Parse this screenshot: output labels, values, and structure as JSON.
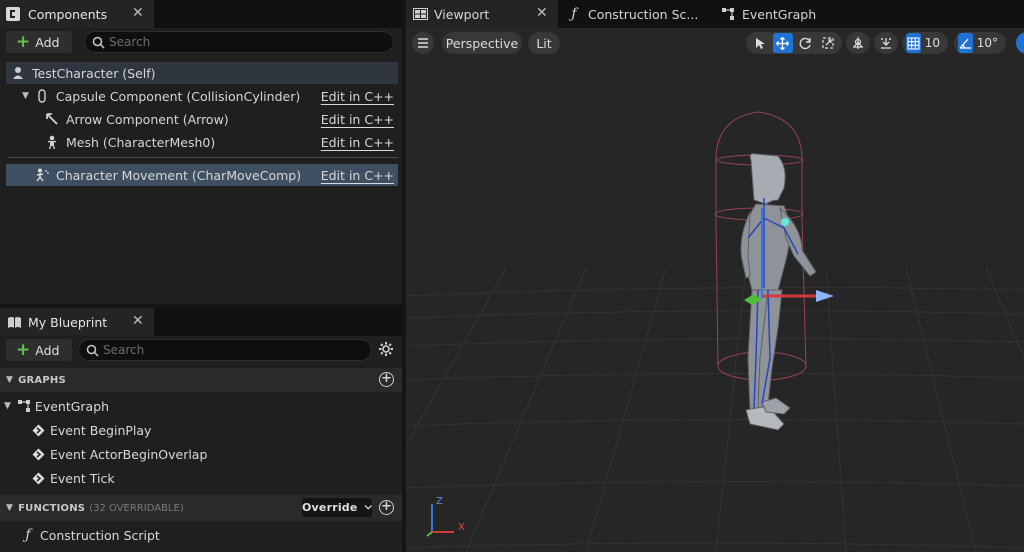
{
  "components_panel": {
    "tab_title": "Components",
    "add_label": "Add",
    "search_placeholder": "Search",
    "root": "TestCharacter (Self)",
    "items": [
      {
        "label": "Capsule Component (CollisionCylinder)",
        "action": "Edit in C++"
      },
      {
        "label": "Arrow Component (Arrow)",
        "action": "Edit in C++"
      },
      {
        "label": "Mesh (CharacterMesh0)",
        "action": "Edit in C++"
      },
      {
        "label": "Character Movement (CharMoveComp)",
        "action": "Edit in C++"
      }
    ]
  },
  "blueprint_panel": {
    "tab_title": "My Blueprint",
    "add_label": "Add",
    "search_placeholder": "Search",
    "graphs_header": "GRAPHS",
    "event_graph": "EventGraph",
    "events": [
      "Event BeginPlay",
      "Event ActorBeginOverlap",
      "Event Tick"
    ],
    "functions_header": "FUNCTIONS",
    "functions_sub": "(32 OVERRIDABLE)",
    "override_label": "Override",
    "functions": [
      "Construction Script"
    ]
  },
  "editor_tabs": [
    {
      "label": "Viewport"
    },
    {
      "label": "Construction Sc..."
    },
    {
      "label": "EventGraph"
    }
  ],
  "viewport": {
    "view_mode": "Perspective",
    "lighting": "Lit",
    "grid_snap": "10",
    "rotation_snap": "10°",
    "axis_x": "X",
    "axis_z": "Z"
  },
  "colors": {
    "accent": "#1f72d6",
    "selection": "#3e4f61",
    "add_plus": "#67c050",
    "axis_x": "#d33a3a",
    "axis_y": "#4fbf3a",
    "axis_z": "#3a78d8"
  }
}
